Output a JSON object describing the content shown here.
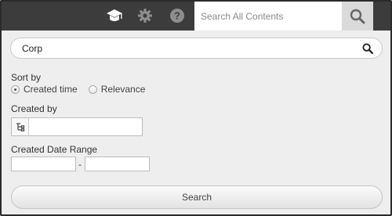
{
  "header": {
    "icons": [
      "graduation-cap-icon",
      "gear-icon",
      "help-icon",
      "search-icon"
    ],
    "global_search_placeholder": "Search All Contents",
    "icon_color": "#ffffff",
    "bar_color": "#3c3c3c"
  },
  "query": {
    "value": "Corp"
  },
  "sort": {
    "label": "Sort by",
    "options": [
      {
        "label": "Created time",
        "checked": true
      },
      {
        "label": "Relevance",
        "checked": false
      }
    ]
  },
  "created_by": {
    "label": "Created by",
    "value": ""
  },
  "date_range": {
    "label": "Created Date Range",
    "separator": "-",
    "from": "",
    "to": ""
  },
  "search_button": {
    "label": "Search"
  }
}
